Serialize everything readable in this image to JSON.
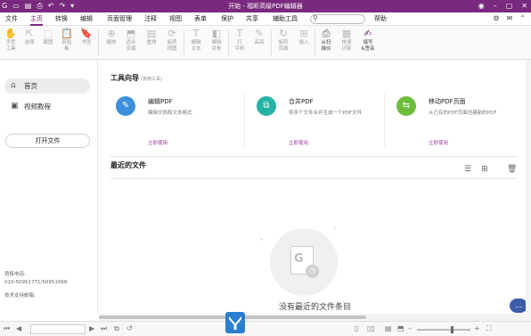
{
  "titlebar": {
    "title": "开始 - 福昕高级PDF编辑器",
    "qa_icons": [
      "app-logo",
      "open-icon",
      "save-icon",
      "print-icon",
      "undo-icon",
      "redo-icon",
      "customize-icon"
    ],
    "controls": [
      "account-icon",
      "minimize-icon",
      "maximize-icon",
      "close-icon"
    ]
  },
  "menu": {
    "items": [
      "文件",
      "主页",
      "转换",
      "编辑",
      "页面管理",
      "注释",
      "视图",
      "表单",
      "保护",
      "共享",
      "辅助工具",
      "帮助"
    ],
    "active": "主页",
    "search_placeholder": ""
  },
  "ribbon": {
    "buttons": [
      {
        "label": "手型\n工具",
        "icon": "hand-icon",
        "enabled": false
      },
      {
        "label": "选择",
        "icon": "select-icon",
        "enabled": false
      },
      {
        "label": "截图",
        "icon": "snapshot-icon",
        "enabled": false
      },
      {
        "label": "剪贴\n板",
        "icon": "clipboard-icon",
        "enabled": false
      },
      {
        "label": "书签",
        "icon": "bookmark-icon",
        "enabled": false
      },
      {
        "label": "缩放",
        "icon": "zoom-icon",
        "enabled": false
      },
      {
        "label": "适合\n页面",
        "icon": "fit-page-icon",
        "enabled": false
      },
      {
        "label": "重排",
        "icon": "reflow-icon",
        "enabled": false
      },
      {
        "label": "旋转\n视图",
        "icon": "rotate-view-icon",
        "enabled": false
      },
      {
        "label": "编辑\n文本",
        "icon": "edit-text-icon",
        "enabled": false
      },
      {
        "label": "编辑\n对象",
        "icon": "edit-object-icon",
        "enabled": false
      },
      {
        "label": "打\n字机",
        "icon": "typewriter-icon",
        "enabled": false
      },
      {
        "label": "高亮",
        "icon": "highlight-icon",
        "enabled": false
      },
      {
        "label": "旋转\n页面",
        "icon": "rotate-page-icon",
        "enabled": false
      },
      {
        "label": "插入",
        "icon": "insert-icon",
        "enabled": false
      },
      {
        "label": "从扫\n描仪",
        "icon": "scanner-icon",
        "enabled": true
      },
      {
        "label": "快速\n识别",
        "icon": "ocr-icon",
        "enabled": false
      },
      {
        "label": "填写\n&签名",
        "icon": "fill-sign-icon",
        "enabled": true
      }
    ]
  },
  "sidebar": {
    "nav": [
      {
        "label": "首页",
        "icon": "home-icon",
        "active": true
      },
      {
        "label": "视频教程",
        "icon": "video-icon",
        "active": false
      }
    ],
    "open_button": "打开文件",
    "sales_label": "销售电话:",
    "sales_phone": "010-50951771/50951668",
    "support_label": "技术支持邮箱:"
  },
  "tools": {
    "title": "工具向导",
    "subtitle": "(常用工具)",
    "cards": [
      {
        "title": "编辑PDF",
        "desc": "编辑文档和文本格式",
        "link": "立即使用",
        "icon": "edit-pdf-icon",
        "color": "#3c8fd9"
      },
      {
        "title": "合并PDF",
        "desc": "将多个文件合并生成一个PDF文件",
        "link": "立即使用",
        "icon": "merge-pdf-icon",
        "color": "#26b3a6"
      },
      {
        "title": "移动PDF页面",
        "desc": "从已有的PDF页面创建新的PDF",
        "link": "立即使用",
        "icon": "move-pages-icon",
        "color": "#6cbd3c"
      }
    ]
  },
  "recent": {
    "title": "最近的文件",
    "empty_text": "没有最近的文件条目"
  },
  "colors": {
    "brand": "#7a2a7e",
    "link": "#9b3a9e"
  }
}
